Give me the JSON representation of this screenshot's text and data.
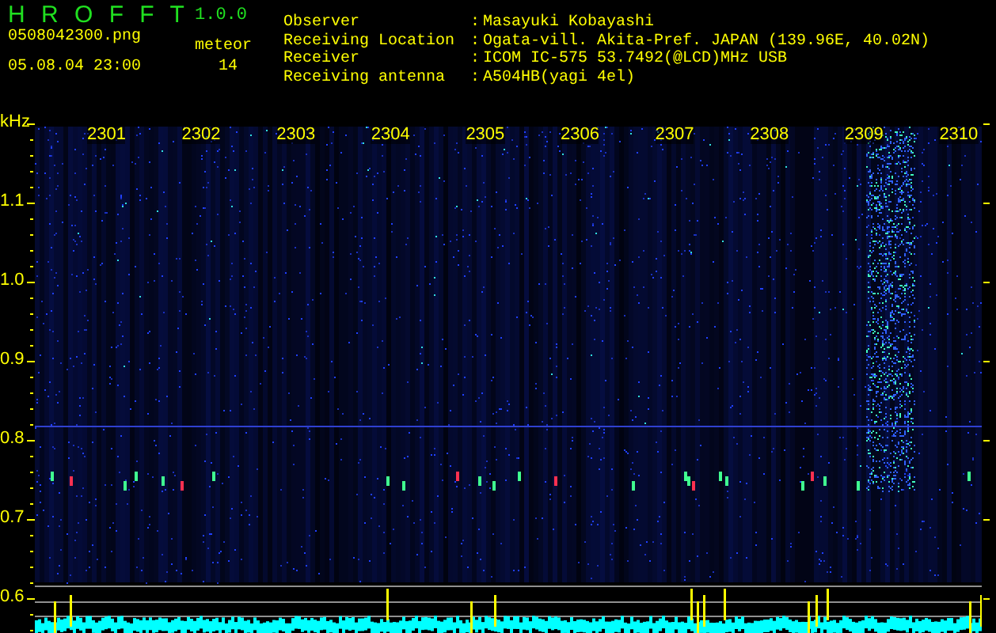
{
  "app": {
    "title": "H R O F F T",
    "version": "1.0.0",
    "file": "0508042300.png",
    "datetime": "05.08.04 23:00",
    "counter_label": "meteor",
    "counter_value": "14"
  },
  "info": [
    {
      "label": "Observer",
      "separator": ":",
      "value": "Masayuki Kobayashi"
    },
    {
      "label": "Receiving Location",
      "separator": ":",
      "value": "Ogata-vill. Akita-Pref. JAPAN (139.96E, 40.02N)"
    },
    {
      "label": "Receiver",
      "separator": ":",
      "value": "ICOM IC-575 53.7492(@LCD)MHz USB"
    },
    {
      "label": "Receiving antenna",
      "separator": ":",
      "value": "A504HB(yagi 4el)"
    }
  ],
  "spectrogram": {
    "unit": "kHz",
    "y_labels": [
      "1.1",
      "1.0",
      "0.9",
      "0.8",
      "0.7",
      "0.6"
    ],
    "time_labels": [
      "2301",
      "2302",
      "2303",
      "2304",
      "2305",
      "2306",
      "2307",
      "2308",
      "2309",
      "2310"
    ]
  }
}
